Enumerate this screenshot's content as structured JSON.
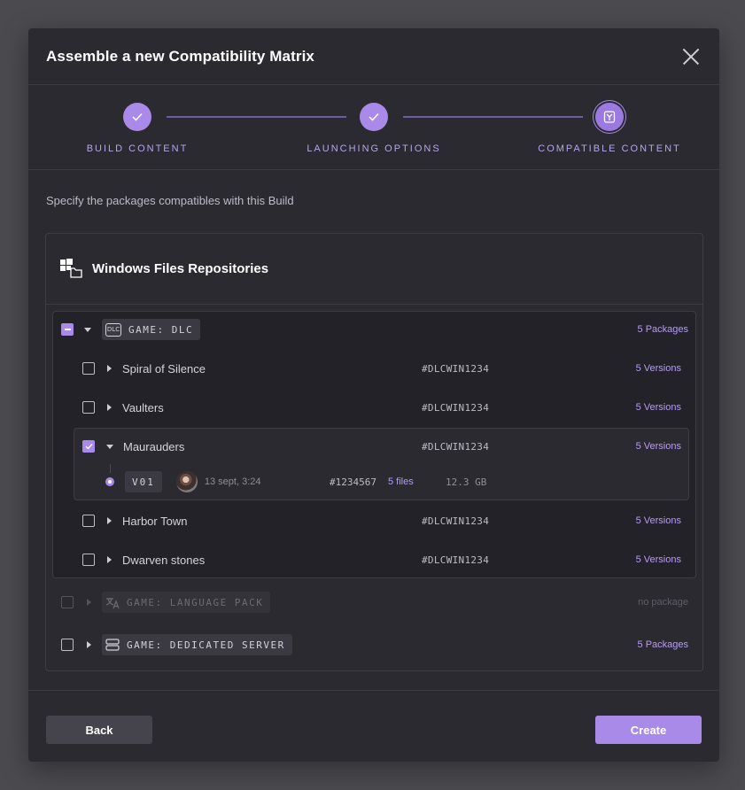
{
  "modal": {
    "title": "Assemble a new Compatibility Matrix"
  },
  "steps": [
    {
      "label": "BUILD CONTENT",
      "state": "done",
      "icon": "check-icon"
    },
    {
      "label": "LAUNCHING OPTIONS",
      "state": "done",
      "icon": "check-icon"
    },
    {
      "label": "COMPATIBLE CONTENT",
      "state": "active",
      "icon": "package-icon"
    }
  ],
  "subtitle": "Specify the packages compatibles with this Build",
  "repository": {
    "title": "Windows Files Repositories",
    "icon": "windows-folder-icon",
    "groups": [
      {
        "tag": "GAME: DLC",
        "tag_icon_text": "DLC",
        "count": "5 Packages",
        "expanded": true,
        "check": "partial",
        "items": [
          {
            "name": "Spiral of Silence",
            "code": "#DLCWIN1234",
            "versions": "5 Versions"
          },
          {
            "name": "Vaulters",
            "code": "#DLCWIN1234",
            "versions": "5 Versions"
          },
          {
            "name": "Maurauders",
            "code": "#DLCWIN1234",
            "versions": "5 Versions",
            "checked": true
          },
          {
            "name": "Harbor Town",
            "code": "#DLCWIN1234",
            "versions": "5 Versions"
          },
          {
            "name": "Dwarven stones",
            "code": "#DLCWIN1234",
            "versions": "5 Versions"
          }
        ],
        "expanded_version": {
          "tag": "V01",
          "date": "13 sept, 3:24",
          "code": "#1234567",
          "files": "5 files",
          "size": "12.3 GB"
        }
      },
      {
        "tag": "GAME: LANGUAGE PACK",
        "count": "no package",
        "disabled": true
      },
      {
        "tag": "GAME: DEDICATED SERVER",
        "count": "5 Packages"
      }
    ]
  },
  "buttons": {
    "back": "Back",
    "create": "Create"
  },
  "colors": {
    "accent": "#a98ae8",
    "background": "#2b2a31"
  }
}
